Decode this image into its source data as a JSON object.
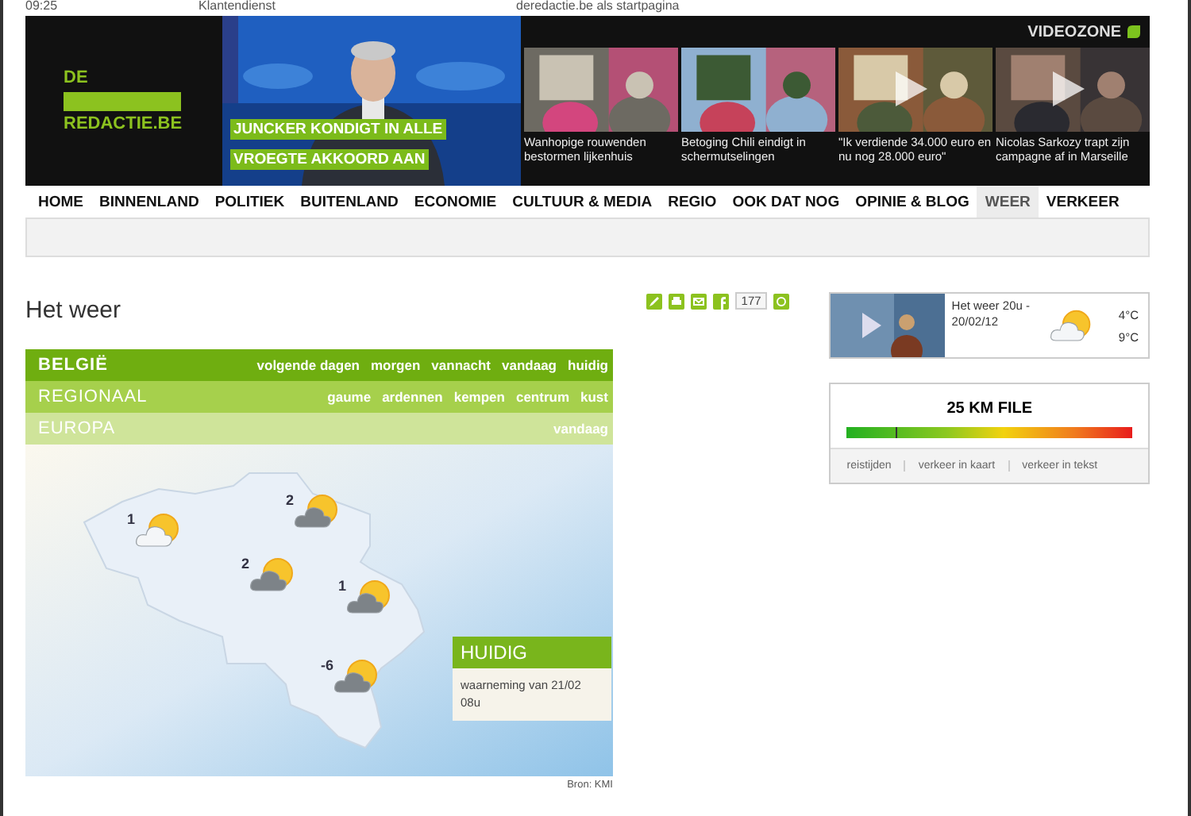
{
  "top_bar": {
    "time": "09:25",
    "links": [
      "Klantendienst",
      "deredactie.be als startpagina"
    ]
  },
  "header": {
    "logo": {
      "top": "DE",
      "bottom": "REDACTIE.BE"
    },
    "headline": "JUNCKER KONDIGT IN ALLE VROEGTE AKKOORD AAN",
    "videozone": {
      "title": "VIDEOZONE",
      "videos": [
        {
          "caption": "Wanhopige rouwenden bestormen lijkenhuis",
          "play": false
        },
        {
          "caption": "Betoging Chili eindigt in schermutselingen",
          "play": false
        },
        {
          "caption": "\"Ik verdiende 34.000 euro en nu nog 28.000 euro\"",
          "play": true
        },
        {
          "caption": "Nicolas Sarkozy trapt zijn campagne af in Marseille",
          "play": true
        }
      ]
    }
  },
  "nav": [
    {
      "label": "HOME",
      "selected": false
    },
    {
      "label": "BINNENLAND",
      "selected": false
    },
    {
      "label": "POLITIEK",
      "selected": false
    },
    {
      "label": "BUITENLAND",
      "selected": false
    },
    {
      "label": "ECONOMIE",
      "selected": false
    },
    {
      "label": "CULTUUR & MEDIA",
      "selected": false
    },
    {
      "label": "REGIO",
      "selected": false
    },
    {
      "label": "OOK DAT NOG",
      "selected": false
    },
    {
      "label": "OPINIE & BLOG",
      "selected": false
    },
    {
      "label": "WEER",
      "selected": true
    },
    {
      "label": "VERKEER",
      "selected": false
    }
  ],
  "page_title": "Het weer",
  "share": {
    "count": "177"
  },
  "weather": {
    "sections": [
      {
        "label": "BELGIË",
        "selected": true,
        "links": [
          "volgende dagen",
          "morgen",
          "vannacht",
          "vandaag",
          "huidig"
        ]
      },
      {
        "label": "REGIONAAL",
        "selected": false,
        "links": [
          "gaume",
          "ardennen",
          "kempen",
          "centrum",
          "kust"
        ]
      },
      {
        "label": "EUROPA",
        "selected": false,
        "links": [
          "vandaag"
        ]
      }
    ],
    "markers": [
      {
        "temp": "1",
        "kind": "light"
      },
      {
        "temp": "2",
        "kind": "dark"
      },
      {
        "temp": "2",
        "kind": "dark"
      },
      {
        "temp": "1",
        "kind": "dark"
      },
      {
        "temp": "-6",
        "kind": "dark"
      }
    ],
    "current": {
      "title": "HUIDIG",
      "text": "waarneming van 21/02 08u"
    },
    "source": "Bron: KMI"
  },
  "weather_video": {
    "title": "Het weer 20u - 20/02/12",
    "min": "4°C",
    "max": "9°C"
  },
  "traffic": {
    "title": "25 KM FILE",
    "level": 0.17,
    "links": [
      "reistijden",
      "verkeer in kaart",
      "verkeer in tekst"
    ]
  }
}
